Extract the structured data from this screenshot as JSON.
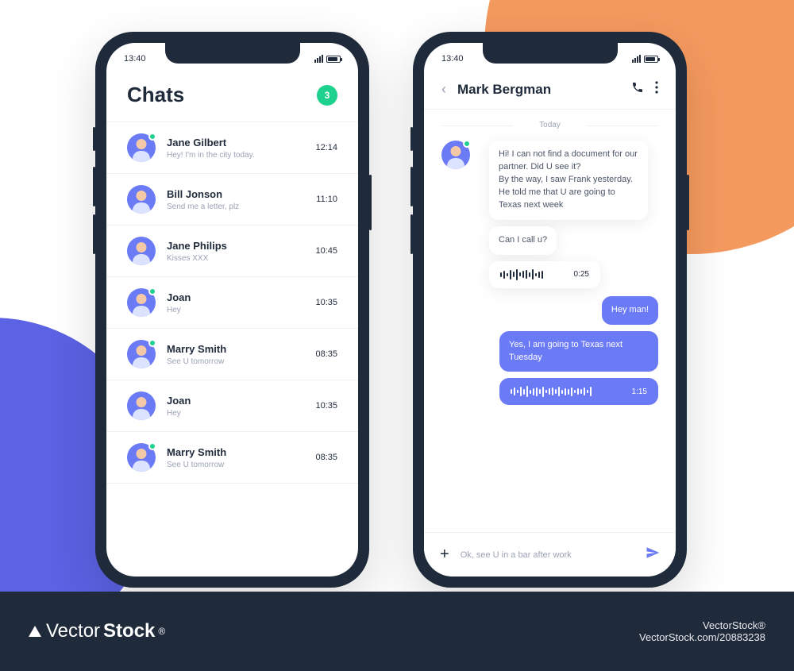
{
  "status": {
    "time": "13:40"
  },
  "chatsScreen": {
    "title": "Chats",
    "badge": "3",
    "items": [
      {
        "name": "Jane Gilbert",
        "preview": "Hey! I'm in the city today.",
        "time": "12:14",
        "online": true
      },
      {
        "name": "Bill Jonson",
        "preview": "Send me a letter, plz",
        "time": "11:10",
        "online": false
      },
      {
        "name": "Jane Philips",
        "preview": "Kisses  XXX",
        "time": "10:45",
        "online": false
      },
      {
        "name": "Joan",
        "preview": "Hey",
        "time": "10:35",
        "online": true
      },
      {
        "name": "Marry Smith",
        "preview": "See U tomorrow",
        "time": "08:35",
        "online": true
      },
      {
        "name": "Joan",
        "preview": "Hey",
        "time": "10:35",
        "online": false
      },
      {
        "name": "Marry Smith",
        "preview": "See U tomorrow",
        "time": "08:35",
        "online": true
      }
    ]
  },
  "convScreen": {
    "contact": "Mark Bergman",
    "dateLabel": "Today",
    "messages": {
      "in1": "Hi! I can not find a document for our partner. Did U see it?\nBy the way, I saw Frank yesterday. He told me that U are going to Texas next week",
      "in2": "Can I call u?",
      "voiceInTime": "0:25",
      "out1": "Hey man!",
      "out2": "Yes, I am going to Texas next Tuesday",
      "voiceOutTime": "1:15"
    },
    "composeText": "Ok, see U in a bar after work"
  },
  "footer": {
    "brand1": "Vector",
    "brand2": "Stock",
    "url": "VectorStock.com/20883238",
    "credit": "VectorStock®"
  }
}
